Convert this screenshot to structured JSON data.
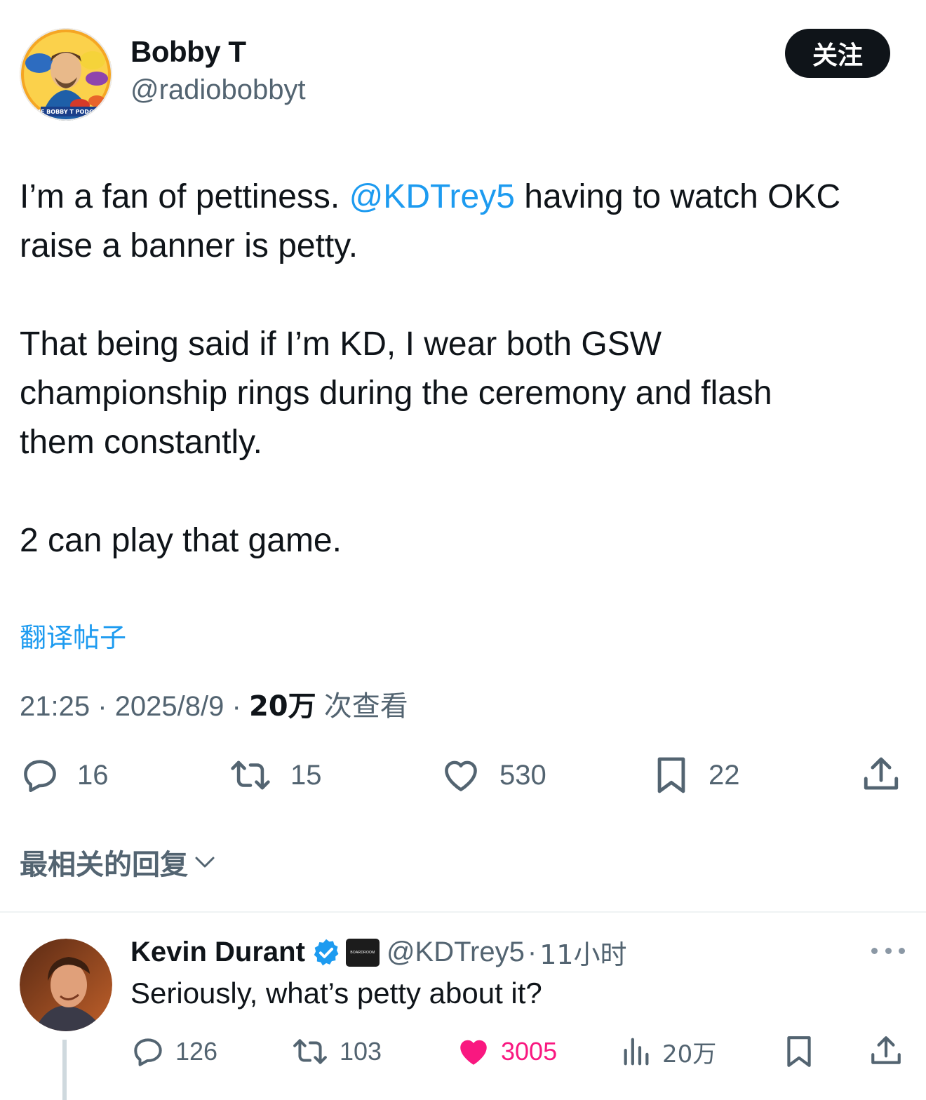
{
  "author": {
    "display_name": "Bobby T",
    "handle": "@radiobobbyt",
    "follow_label": "关注",
    "avatar_banner_text": "THE BOBBY T PODCAST"
  },
  "tweet": {
    "line1_pre": "I’m a fan of pettiness. ",
    "mention": "@KDTrey5",
    "line1_post": " having to watch OKC",
    "line2": "raise a banner is petty.",
    "line3": "That being said if I’m KD, I wear both GSW",
    "line4": "championship rings during the ceremony and flash",
    "line5": "them constantly.",
    "line6": "2 can play that game.",
    "translate_label": "翻译帖子",
    "time": "21:25",
    "date": "2025/8/9",
    "separator": "·",
    "views_count": "20万",
    "views_label": "次查看"
  },
  "actions": {
    "replies": "16",
    "reposts": "15",
    "likes": "530",
    "bookmarks": "22"
  },
  "sort": {
    "label": "最相关的回复"
  },
  "reply": {
    "name": "Kevin Durant",
    "affiliate_badge_text": "BOARDROOM",
    "handle": "@KDTrey5",
    "separator": "·",
    "time": "11小时",
    "text": "Seriously, what’s petty about it?",
    "replies": "126",
    "reposts": "103",
    "likes": "3005",
    "views": "20万"
  },
  "colors": {
    "accent": "#1d9bf0",
    "like_active": "#f91880",
    "muted": "#536471",
    "text": "#0f1419"
  }
}
